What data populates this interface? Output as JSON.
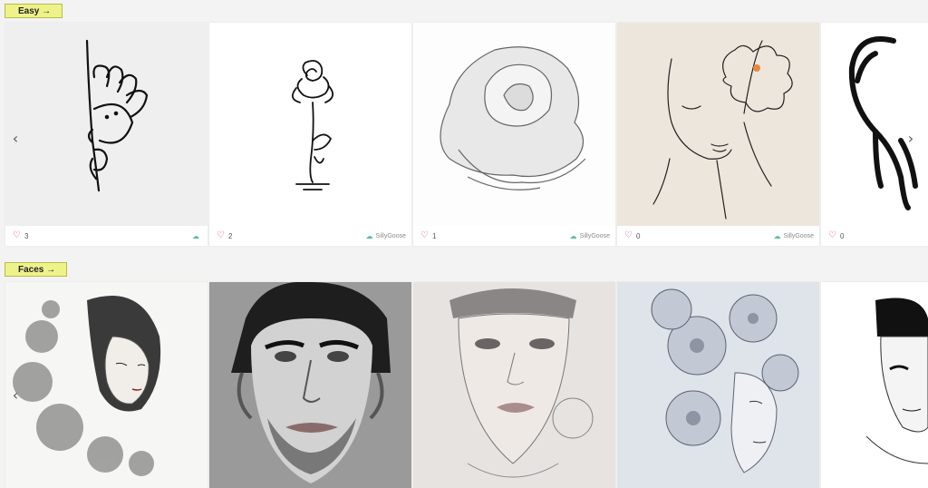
{
  "sections": [
    {
      "label": "Easy →",
      "cards": [
        {
          "likes": "3",
          "author": ""
        },
        {
          "likes": "2",
          "author": "SillyGoose"
        },
        {
          "likes": "1",
          "author": "SillyGoose"
        },
        {
          "likes": "0",
          "author": "SillyGoose"
        },
        {
          "likes": "0",
          "author": ""
        }
      ]
    },
    {
      "label": "Faces →"
    }
  ],
  "icons": {
    "like": "heart-icon",
    "author_badge": "bolt-icon",
    "prev": "chevron-left-icon",
    "next": "chevron-right-icon"
  },
  "colors": {
    "tag_bg": "#eef28a",
    "heart": "#e0476b",
    "badge": "#57c28f"
  }
}
